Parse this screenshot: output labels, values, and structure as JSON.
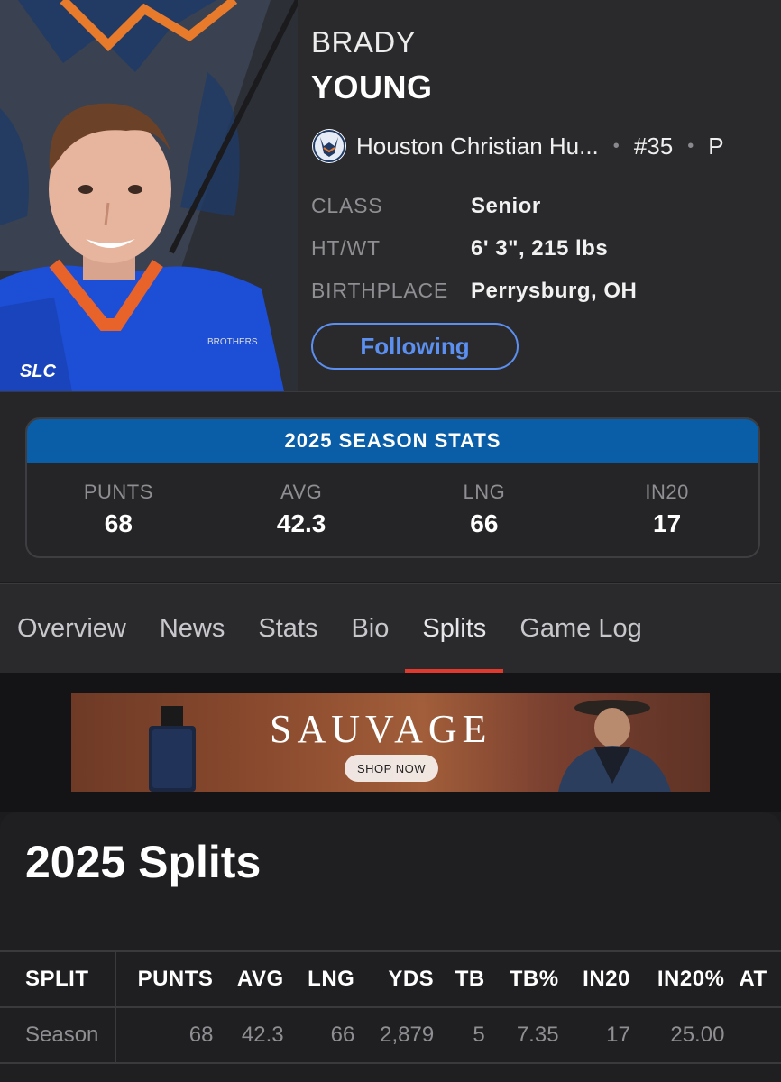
{
  "player": {
    "first_name": "BRADY",
    "last_name": "YOUNG",
    "team_name": "Houston Christian Hu...",
    "number": "#35",
    "position": "P",
    "info": [
      {
        "label": "CLASS",
        "value": "Senior"
      },
      {
        "label": "HT/WT",
        "value": "6' 3\", 215 lbs"
      },
      {
        "label": "BIRTHPLACE",
        "value": "Perrysburg, OH"
      }
    ],
    "follow_label": "Following"
  },
  "season_stats": {
    "title": "2025 SEASON STATS",
    "stats": [
      {
        "label": "PUNTS",
        "value": "68"
      },
      {
        "label": "AVG",
        "value": "42.3"
      },
      {
        "label": "LNG",
        "value": "66"
      },
      {
        "label": "IN20",
        "value": "17"
      }
    ]
  },
  "tabs": [
    "Overview",
    "News",
    "Stats",
    "Bio",
    "Splits",
    "Game Log"
  ],
  "active_tab": "Splits",
  "ad": {
    "brand": "SAUVAGE",
    "button": "SHOP NOW"
  },
  "splits": {
    "title": "2025 Splits",
    "columns": [
      "SPLIT",
      "PUNTS",
      "AVG",
      "LNG",
      "YDS",
      "TB",
      "TB%",
      "IN20",
      "IN20%",
      "AT"
    ],
    "rows": [
      [
        "Season",
        "68",
        "42.3",
        "66",
        "2,879",
        "5",
        "7.35",
        "17",
        "25.00",
        ""
      ]
    ]
  },
  "colors": {
    "accent_blue": "#0a5ea8",
    "follow_blue": "#5b8ff0",
    "tab_indicator": "#e03a2f"
  }
}
